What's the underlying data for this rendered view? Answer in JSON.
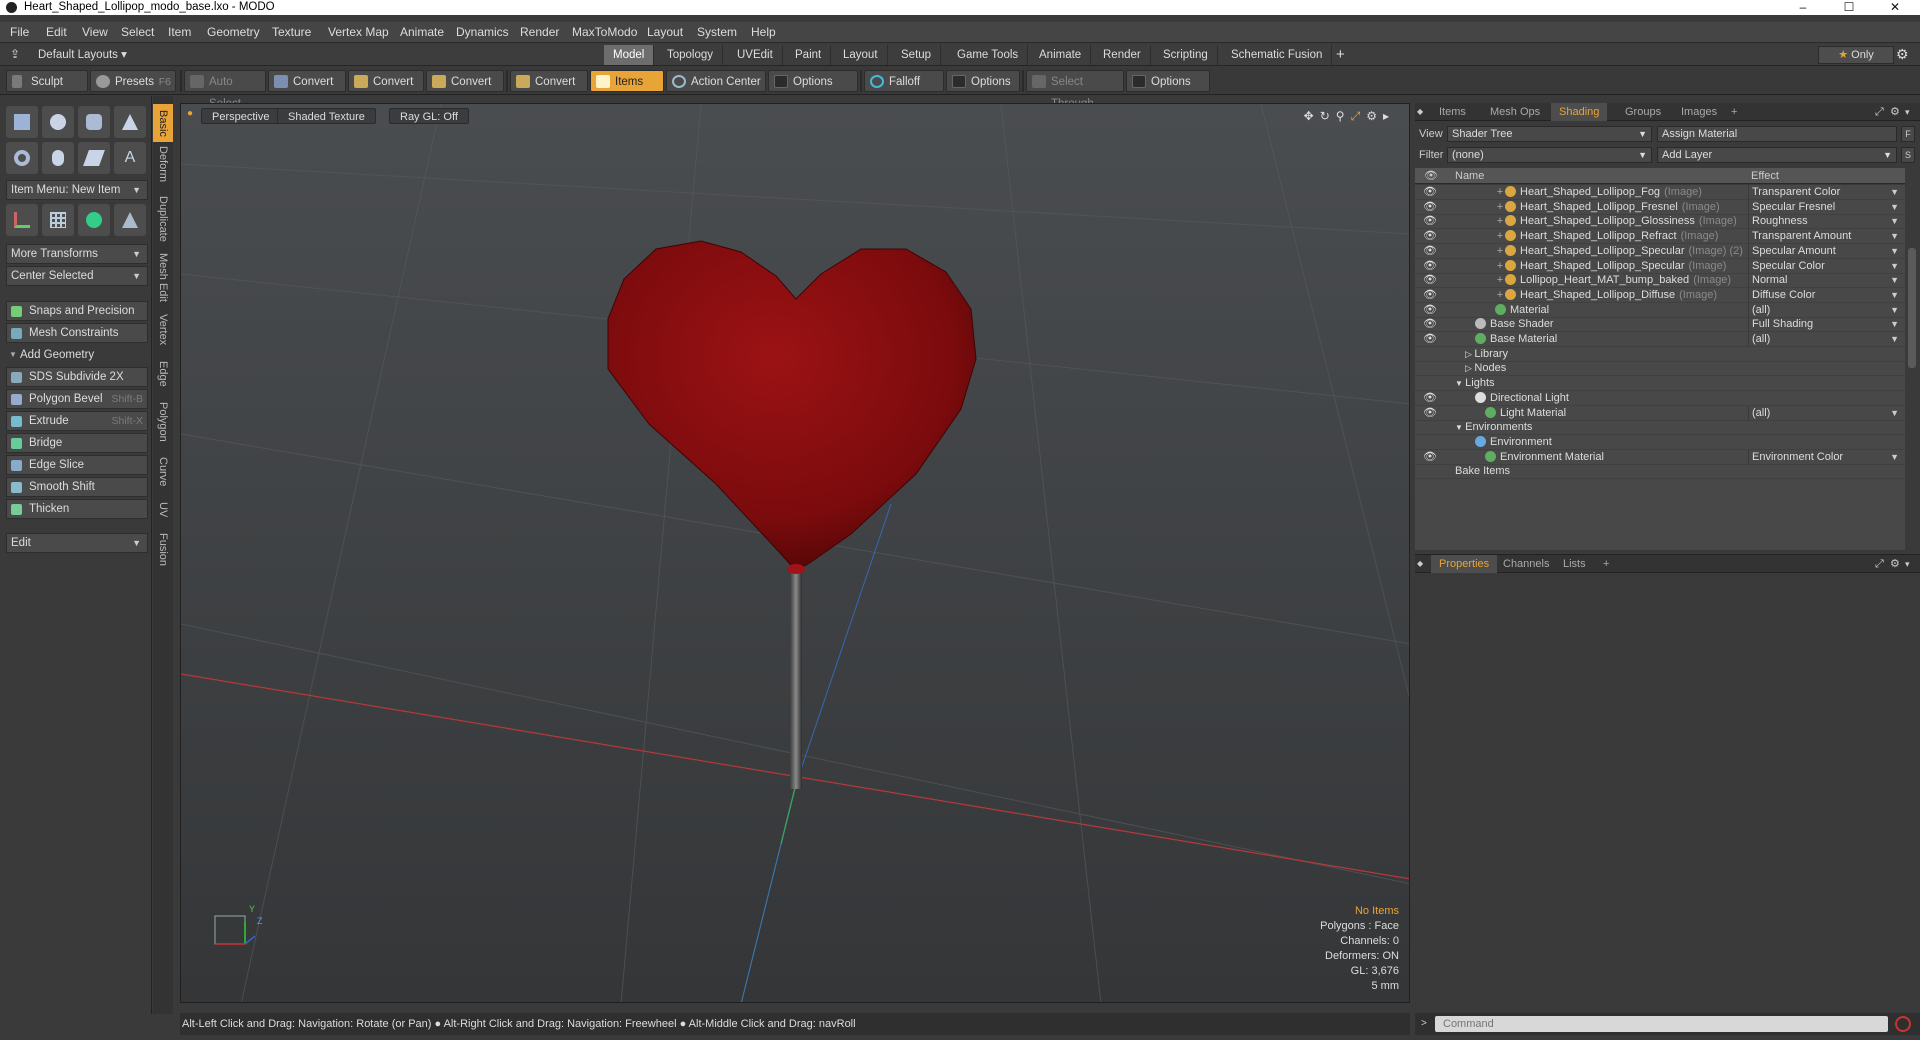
{
  "window": {
    "title": "Heart_Shaped_Lollipop_modo_base.lxo - MODO",
    "controls": [
      "–",
      "☐",
      "✕"
    ]
  },
  "menu": [
    "File",
    "Edit",
    "View",
    "Select",
    "Item",
    "Geometry",
    "Texture",
    "Vertex Map",
    "Animate",
    "Dynamics",
    "Render",
    "MaxToModo",
    "Layout",
    "System",
    "Help"
  ],
  "layoutbar": {
    "layouts_label": "Default Layouts",
    "tabs": [
      "Model",
      "Topology",
      "UVEdit",
      "Paint",
      "Layout",
      "Setup",
      "Game Tools",
      "Animate",
      "Render",
      "Scripting",
      "Schematic Fusion"
    ],
    "active_tab": "Model",
    "plus": "+",
    "only_label": "Only"
  },
  "toolbar": {
    "sculpt": "Sculpt",
    "presets": "Presets",
    "presets_shortcut": "F6",
    "auto_select": "Auto Select",
    "convert1": "Convert",
    "convert2": "Convert",
    "convert3": "Convert",
    "convert4": "Convert",
    "items": "Items",
    "action_center": "Action Center",
    "options1": "Options",
    "falloff": "Falloff",
    "options2": "Options",
    "select_through": "Select Through",
    "options3": "Options"
  },
  "lefttools": {
    "item_menu": "Item Menu: New Item",
    "more_transforms": "More Transforms",
    "center_selected": "Center Selected",
    "snaps": "Snaps and Precision",
    "mesh_constraints": "Mesh Constraints",
    "add_geometry": "Add Geometry",
    "tools": [
      {
        "label": "SDS Subdivide 2X",
        "shortcut": ""
      },
      {
        "label": "Polygon Bevel",
        "shortcut": "Shift-B"
      },
      {
        "label": "Extrude",
        "shortcut": "Shift-X"
      },
      {
        "label": "Bridge",
        "shortcut": ""
      },
      {
        "label": "Edge Slice",
        "shortcut": ""
      },
      {
        "label": "Smooth Shift",
        "shortcut": ""
      },
      {
        "label": "Thicken",
        "shortcut": ""
      }
    ],
    "edit": "Edit"
  },
  "vtabs": [
    "Basic",
    "Deform",
    "Duplicate",
    "Mesh Edit",
    "Vertex",
    "Edge",
    "Polygon",
    "Curve",
    "UV",
    "Fusion"
  ],
  "viewport": {
    "view": "Perspective",
    "shading": "Shaded Texture",
    "raygl": "Ray GL: Off",
    "hud": {
      "items": "No Items",
      "polygons": "Polygons : Face",
      "channels": "Channels: 0",
      "deformers": "Deformers: ON",
      "gl": "GL: 3,676",
      "unit": "5 mm"
    },
    "axis_y": "Y",
    "axis_z": "Z"
  },
  "statusbar": "Alt-Left Click and Drag: Navigation: Rotate (or Pan) ● Alt-Right Click and Drag: Navigation: Freewheel ● Alt-Middle Click and Drag: navRoll",
  "rightpanel": {
    "tabs": [
      "Items",
      "Mesh Ops",
      "Shading",
      "Groups",
      "Images",
      "+"
    ],
    "active_tab": "Shading",
    "view_label": "View",
    "view_value": "Shader Tree",
    "assign_material": "Assign Material",
    "filter_label": "Filter",
    "filter_value": "(none)",
    "add_layer": "Add Layer",
    "col_name": "Name",
    "col_effect": "Effect",
    "rows": [
      {
        "name": "Heart_Shaped_Lollipop_Fog",
        "suffix": "(Image)",
        "effect": "Transparent Color",
        "indent": 4,
        "icon": "image"
      },
      {
        "name": "Heart_Shaped_Lollipop_Fresnel",
        "suffix": "(Image)",
        "effect": "Specular Fresnel",
        "indent": 4,
        "icon": "image"
      },
      {
        "name": "Heart_Shaped_Lollipop_Glossiness",
        "suffix": "(Image)",
        "effect": "Roughness",
        "indent": 4,
        "icon": "image"
      },
      {
        "name": "Heart_Shaped_Lollipop_Refract",
        "suffix": "(Image)",
        "effect": "Transparent Amount",
        "indent": 4,
        "icon": "image"
      },
      {
        "name": "Heart_Shaped_Lollipop_Specular",
        "suffix": "(Image) (2)",
        "effect": "Specular Amount",
        "indent": 4,
        "icon": "image"
      },
      {
        "name": "Heart_Shaped_Lollipop_Specular",
        "suffix": "(Image)",
        "effect": "Specular Color",
        "indent": 4,
        "icon": "image"
      },
      {
        "name": "Lollipop_Heart_MAT_bump_baked",
        "suffix": "(Image)",
        "effect": "Normal",
        "indent": 4,
        "icon": "image"
      },
      {
        "name": "Heart_Shaped_Lollipop_Diffuse",
        "suffix": "(Image)",
        "effect": "Diffuse Color",
        "indent": 4,
        "icon": "image"
      },
      {
        "name": "Material",
        "suffix": "",
        "effect": "(all)",
        "indent": 4,
        "icon": "material"
      },
      {
        "name": "Base Shader",
        "suffix": "",
        "effect": "Full Shading",
        "indent": 2,
        "icon": "shader"
      },
      {
        "name": "Base Material",
        "suffix": "",
        "effect": "(all)",
        "indent": 2,
        "icon": "material"
      },
      {
        "name": "Library",
        "suffix": "",
        "effect": "",
        "indent": 1,
        "icon": "folder"
      },
      {
        "name": "Nodes",
        "suffix": "",
        "effect": "",
        "indent": 1,
        "icon": "folder"
      },
      {
        "name": "Lights",
        "suffix": "",
        "effect": "",
        "indent": 0,
        "icon": "none"
      },
      {
        "name": "Directional Light",
        "suffix": "",
        "effect": "",
        "indent": 2,
        "icon": "light"
      },
      {
        "name": "Light Material",
        "suffix": "",
        "effect": "(all)",
        "indent": 3,
        "icon": "material"
      },
      {
        "name": "Environments",
        "suffix": "",
        "effect": "",
        "indent": 0,
        "icon": "none"
      },
      {
        "name": "Environment",
        "suffix": "",
        "effect": "",
        "indent": 2,
        "icon": "env"
      },
      {
        "name": "Environment Material",
        "suffix": "",
        "effect": "Environment Color",
        "indent": 3,
        "icon": "material"
      },
      {
        "name": "Bake Items",
        "suffix": "",
        "effect": "",
        "indent": 0,
        "icon": "none"
      }
    ]
  },
  "proppanel": {
    "tabs": [
      "Properties",
      "Channels",
      "Lists",
      "+"
    ],
    "active_tab": "Properties"
  },
  "command": {
    "placeholder": "Command"
  },
  "colors": {
    "accent": "#e9a437",
    "heart": "#8e0f10",
    "image_icon": "#d9a640",
    "material_icon": "#5fae5f"
  }
}
